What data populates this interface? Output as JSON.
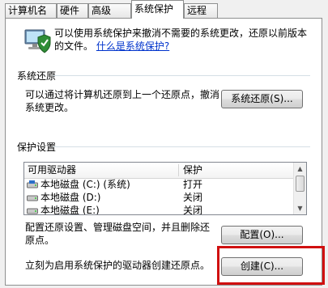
{
  "tabs": [
    {
      "label": "计算机名",
      "active": false
    },
    {
      "label": "硬件",
      "active": false
    },
    {
      "label": "高级",
      "active": false
    },
    {
      "label": "系统保护",
      "active": true
    },
    {
      "label": "远程",
      "active": false
    }
  ],
  "intro": {
    "text": "可以使用系统保护来撤消不需要的系统更改，还原以前版本的文件。",
    "link": "什么是系统保护?",
    "icon": "computer-shield-icon"
  },
  "system_restore": {
    "title": "系统还原",
    "description": "可以通过将计算机还原到上一个还原点，撤消系统更改。",
    "button": "系统还原(S)..."
  },
  "protection": {
    "title": "保护设置",
    "columns": [
      "可用驱动器",
      "保护"
    ],
    "drives": [
      {
        "name": "本地磁盘 (C:) (系统)",
        "status": "打开",
        "icon": "system-drive-icon"
      },
      {
        "name": "本地磁盘 (D:)",
        "status": "关闭",
        "icon": "drive-icon"
      },
      {
        "name": "本地磁盘 (E:)",
        "status": "关闭",
        "icon": "drive-icon"
      }
    ],
    "configure_text": "配置还原设置、管理磁盘空间，并且删除还原点。",
    "configure_button": "配置(O)...",
    "create_text": "立刻为启用系统保护的驱动器创建还原点。",
    "create_button": "创建(C)..."
  },
  "colors": {
    "highlight": "#d01010",
    "link": "#0033cc"
  }
}
